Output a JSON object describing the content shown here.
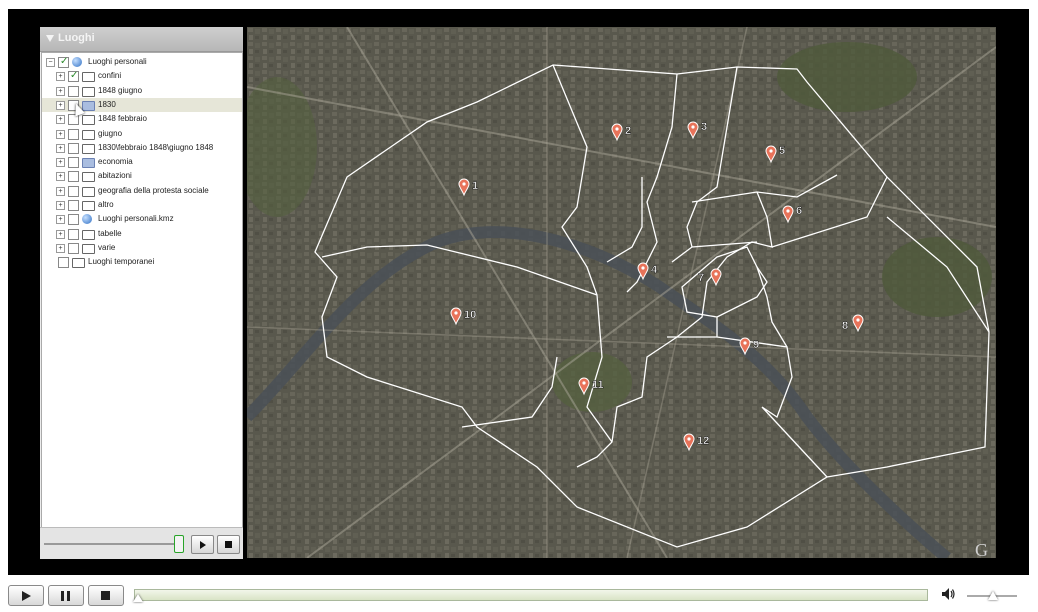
{
  "sidebar": {
    "title": "Luoghi",
    "items": [
      {
        "label": "Luoghi personali",
        "icon": "globe-icon",
        "checked": true,
        "selected": false
      },
      {
        "label": "confini",
        "icon": "folder-icon",
        "checked": true,
        "selected": false
      },
      {
        "label": "1848 giugno",
        "icon": "folder-icon",
        "checked": false,
        "selected": false
      },
      {
        "label": "1830",
        "icon": "folder-icon",
        "checked": false,
        "selected": true
      },
      {
        "label": "1848 febbraio",
        "icon": "folder-icon",
        "checked": false,
        "selected": false
      },
      {
        "label": "giugno",
        "icon": "folder-icon",
        "checked": false,
        "selected": false
      },
      {
        "label": "1830\\febbraio 1848\\giugno 1848",
        "icon": "folder-icon",
        "checked": false,
        "selected": false
      },
      {
        "label": "economia",
        "icon": "folder-icon",
        "checked": false,
        "selected": false
      },
      {
        "label": "abitazioni",
        "icon": "folder-icon",
        "checked": false,
        "selected": false
      },
      {
        "label": "geografia della protesta sociale",
        "icon": "folder-icon",
        "checked": false,
        "selected": false
      },
      {
        "label": "altro",
        "icon": "folder-icon",
        "checked": false,
        "selected": false
      },
      {
        "label": "Luoghi personali.kmz",
        "icon": "globe-icon",
        "checked": false,
        "selected": false
      },
      {
        "label": "tabelle",
        "icon": "folder-icon",
        "checked": false,
        "selected": false
      },
      {
        "label": "varie",
        "icon": "folder-icon",
        "checked": false,
        "selected": false
      },
      {
        "label": "Luoghi temporanei",
        "icon": "folder-icon",
        "checked": false,
        "selected": false
      }
    ],
    "tour_slider_level": 1.0
  },
  "map": {
    "markers": [
      "1",
      "2",
      "3",
      "4",
      "5",
      "6",
      "7",
      "8",
      "9",
      "10",
      "11",
      "12"
    ],
    "watermark": "G"
  },
  "player": {
    "progress": 0.0,
    "volume": 0.5
  },
  "colors": {
    "marker": "#e8735a",
    "boundary": "#ffffff",
    "frame": "#000000",
    "progress_fill": "#dbe5c9"
  }
}
